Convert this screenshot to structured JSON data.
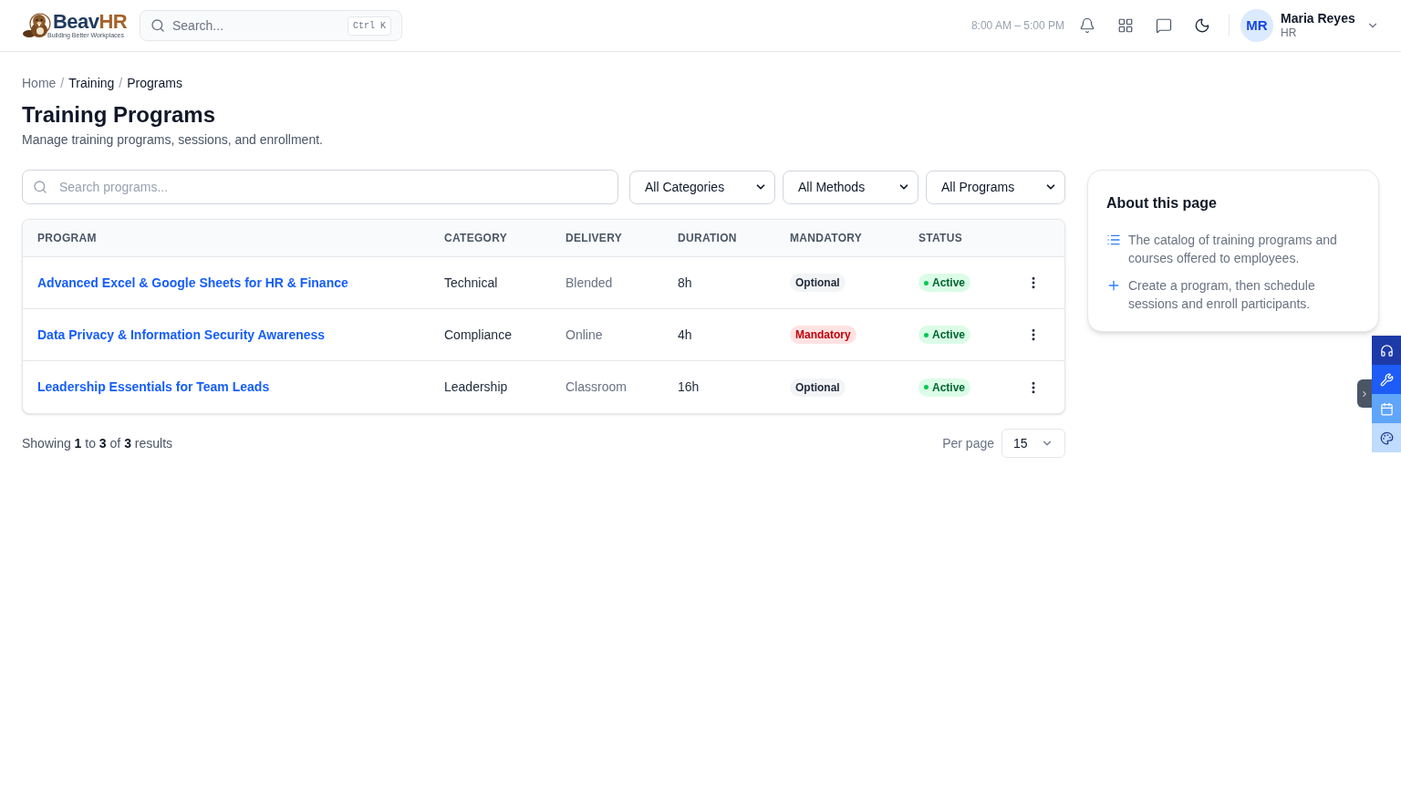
{
  "header": {
    "brand": {
      "parts": [
        {
          "text": "Beav",
          "color": "#1f3a5c"
        },
        {
          "text": "HR",
          "color": "#a5622a"
        }
      ],
      "tagline": "Building Better Workplaces"
    },
    "search": {
      "placeholder": "Search...",
      "shortcut": "Ctrl K"
    },
    "shift_hours": "8:00 AM – 5:00 PM",
    "user": {
      "initials": "MR",
      "name": "Maria Reyes",
      "role": "HR"
    }
  },
  "breadcrumb": {
    "separator": "/",
    "items": [
      {
        "label": "Home",
        "muted": true
      },
      {
        "label": "Training",
        "muted": false
      },
      {
        "label": "Programs",
        "muted": false
      }
    ]
  },
  "page": {
    "title": "Training Programs",
    "subtitle": "Manage training programs, sessions, and enrollment."
  },
  "filters": {
    "search": {
      "placeholder": "Search programs..."
    },
    "selects": [
      {
        "value": "All Categories"
      },
      {
        "value": "All Methods"
      },
      {
        "value": "All Programs"
      }
    ]
  },
  "table": {
    "columns": [
      "PROGRAM",
      "CATEGORY",
      "DELIVERY",
      "DURATION",
      "MANDATORY",
      "STATUS"
    ],
    "rows": [
      {
        "program": "Advanced Excel & Google Sheets for HR & Finance",
        "category": "Technical",
        "delivery": "Blended",
        "duration": "8h",
        "mandatory": {
          "label": "Optional",
          "required": false
        },
        "status": {
          "label": "Active",
          "active": true
        }
      },
      {
        "program": "Data Privacy & Information Security Awareness",
        "category": "Compliance",
        "delivery": "Online",
        "duration": "4h",
        "mandatory": {
          "label": "Mandatory",
          "required": true
        },
        "status": {
          "label": "Active",
          "active": true
        }
      },
      {
        "program": "Leadership Essentials for Team Leads",
        "category": "Leadership",
        "delivery": "Classroom",
        "duration": "16h",
        "mandatory": {
          "label": "Optional",
          "required": false
        },
        "status": {
          "label": "Active",
          "active": true
        }
      }
    ]
  },
  "pagination": {
    "summary": "Showing **1** to **3** of **3** results",
    "per_page_label": "Per page",
    "per_page": "15"
  },
  "about": {
    "title": "About this page",
    "items": [
      {
        "kind": "list",
        "text": "The catalog of training programs and courses offered to employees."
      },
      {
        "kind": "add",
        "text": "Create a program, then schedule sessions and enroll participants."
      }
    ]
  }
}
